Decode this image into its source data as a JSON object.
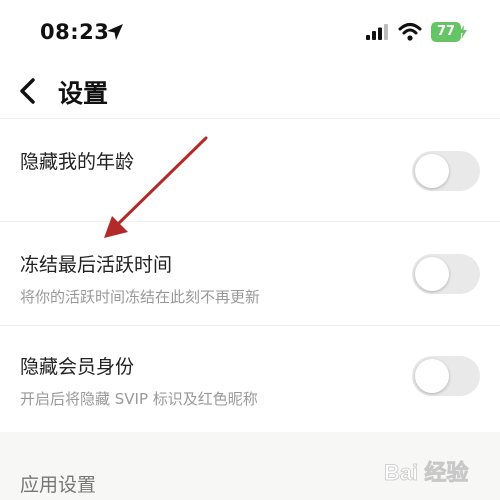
{
  "status_bar": {
    "time": "08:23",
    "battery": "77",
    "icons": [
      "location-arrow-icon",
      "signal-icon",
      "wifi-icon",
      "battery-icon"
    ]
  },
  "nav": {
    "title": "设置",
    "back_icon": "chevron-left-icon"
  },
  "settings": [
    {
      "title": "隐藏我的年龄",
      "description": "",
      "enabled": false
    },
    {
      "title": "冻结最后活跃时间",
      "description": "将你的活跃时间冻结在此刻不再更新",
      "enabled": false
    },
    {
      "title": "隐藏会员身份",
      "description": "开启后将隐藏 SVIP 标识及红色昵称",
      "enabled": false
    }
  ],
  "section": {
    "title": "应用设置"
  },
  "watermark": {
    "text": "Bai 经验"
  },
  "colors": {
    "toggle_off": "#e9e9ea",
    "battery": "#65c466",
    "annotation_arrow": "#b22a2a"
  }
}
